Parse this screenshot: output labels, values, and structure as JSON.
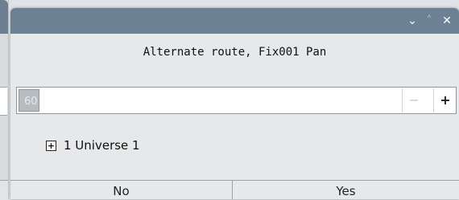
{
  "dialog": {
    "window_controls": {
      "minimize_glyph": "⌄",
      "maximize_glyph": "˄",
      "close_glyph": "✕"
    },
    "message": "Alternate route, Fix001 Pan",
    "spinbox": {
      "value": "60",
      "minus_glyph": "−",
      "plus_glyph": "+"
    },
    "tree": {
      "expander_glyph": "+",
      "item_label": "1 Universe 1"
    },
    "buttons": {
      "no_label": "No",
      "yes_label": "Yes"
    }
  },
  "colors": {
    "titlebar": "#6c8194",
    "dialog_bg": "#e6e8ea",
    "field_bg": "#ffffff"
  }
}
